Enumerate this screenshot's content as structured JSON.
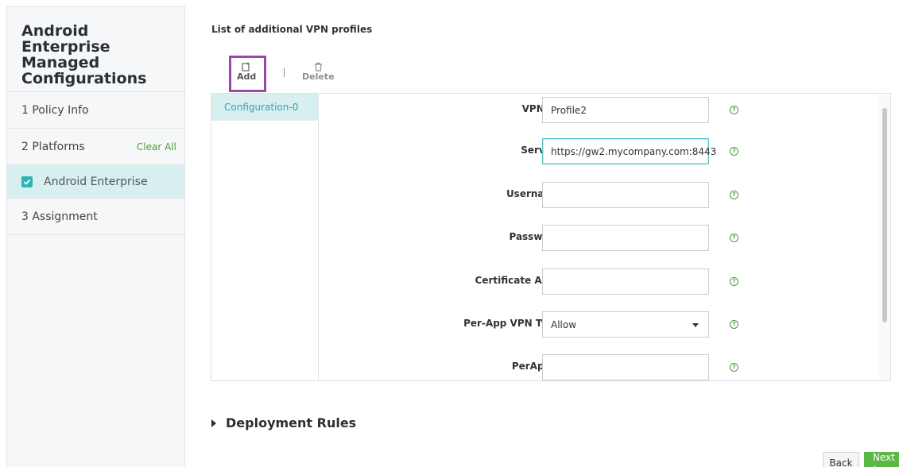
{
  "sidebar": {
    "title": "Android Enterprise Managed Configurations",
    "steps": [
      {
        "label": "1  Policy Info"
      },
      {
        "label": "2  Platforms",
        "action": "Clear All"
      },
      {
        "label": "Android Enterprise",
        "checked": true
      },
      {
        "label": "3  Assignment"
      }
    ]
  },
  "main": {
    "section_label": "List of additional VPN profiles",
    "toolbar": {
      "add_label": "Add",
      "delete_label": "Delete"
    },
    "configurations": [
      "Configuration-0"
    ],
    "fields": [
      {
        "label": "VPN Profile Name",
        "value": "Profile2"
      },
      {
        "label": "Server Address(*)",
        "value": "https://gw2.mycompany.com:8443"
      },
      {
        "label": "Username (optional)",
        "value": ""
      },
      {
        "label": "Password (optional)",
        "value": ""
      },
      {
        "label": "Certificate Alias (optional)",
        "value": ""
      },
      {
        "label": "Per-App VPN Type (optional)",
        "value": "Allow"
      },
      {
        "label": "PerAppVPN app list",
        "value": ""
      }
    ],
    "help_icon_glyph": "?",
    "deployment_rules": "Deployment Rules"
  },
  "footer": {
    "back_label": "Back",
    "next_label": "Next >"
  },
  "colors": {
    "accent_teal": "#2fb3b9",
    "accent_green": "#5cb845",
    "highlight_purple": "#9a48a8"
  }
}
